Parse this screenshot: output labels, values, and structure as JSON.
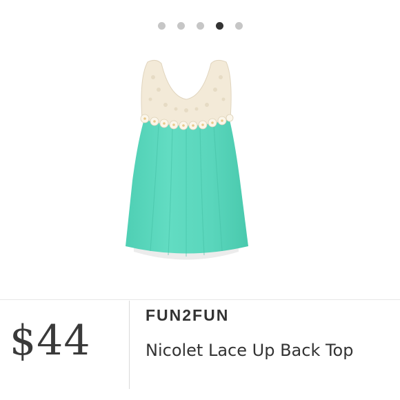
{
  "carousel": {
    "dot_count": 5,
    "active_index": 3
  },
  "product": {
    "brand": "FUN2FUN",
    "price": "$44",
    "title": "Nicolet Lace Up Back Top",
    "colors": {
      "body": "#5cd9bf",
      "lace": "#f3ead8"
    }
  }
}
